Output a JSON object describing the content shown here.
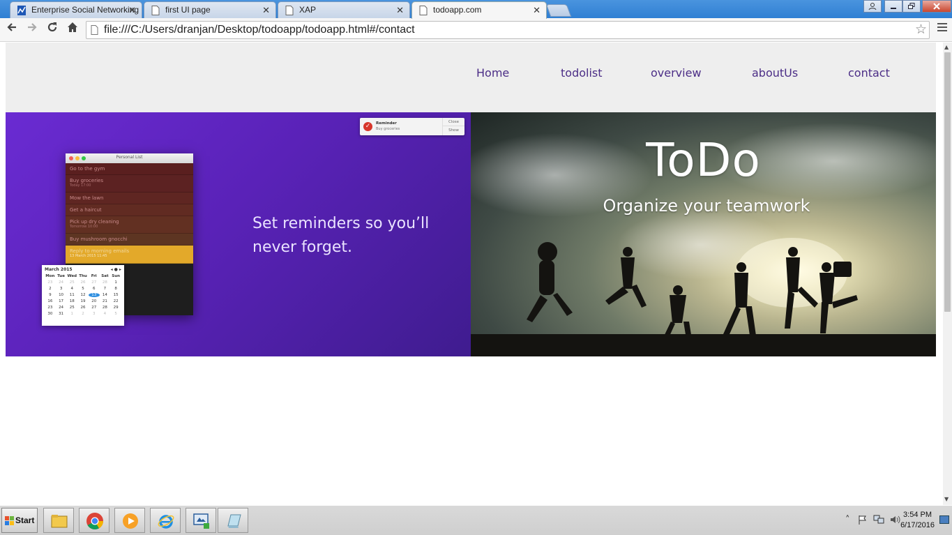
{
  "browser": {
    "tabs": [
      {
        "title": "Enterprise Social Networking",
        "active": false,
        "icon": "chart-favicon-icon"
      },
      {
        "title": "first UI page",
        "active": false,
        "icon": "page-icon"
      },
      {
        "title": "XAP",
        "active": false,
        "icon": "page-icon"
      },
      {
        "title": "todoapp.com",
        "active": true,
        "icon": "page-icon"
      }
    ],
    "tab_close_glyph": "✕",
    "url": "file:///C:/Users/dranjan/Desktop/todoapp/todoapp.html#/contact"
  },
  "site": {
    "nav": [
      "Home",
      "todolist",
      "overview",
      "aboutUs",
      "contact"
    ],
    "nav_color": "#4b2d86",
    "hero_left": {
      "tagline": "Set reminders so you’ll never forget.",
      "gradient": [
        "#6a2bd2",
        "#3f1c8f"
      ],
      "mock_app": {
        "title": "Personal List",
        "items": [
          {
            "text": "Go to the gym",
            "sub": ""
          },
          {
            "text": "Buy groceries",
            "sub": "Today 17:00"
          },
          {
            "text": "Mow the lawn",
            "sub": ""
          },
          {
            "text": "Get a haircut",
            "sub": ""
          },
          {
            "text": "Pick up dry cleaning",
            "sub": "Tomorrow 10:00"
          },
          {
            "text": "Buy mushroom gnocchi",
            "sub": ""
          },
          {
            "text": "Reply to morning emails",
            "sub": "13 March 2015 11:45"
          }
        ]
      },
      "calendar": {
        "month": "March 2015",
        "weekdays": [
          "Mon",
          "Tue",
          "Wed",
          "Thu",
          "Fri",
          "Sat",
          "Sun"
        ],
        "days": [
          "23",
          "24",
          "25",
          "26",
          "27",
          "28",
          "1",
          "2",
          "3",
          "4",
          "5",
          "6",
          "7",
          "8",
          "9",
          "10",
          "11",
          "12",
          "13",
          "14",
          "15",
          "16",
          "17",
          "18",
          "19",
          "20",
          "21",
          "22",
          "23",
          "24",
          "25",
          "26",
          "27",
          "28",
          "29",
          "30",
          "31",
          "1",
          "2",
          "3",
          "4",
          "5"
        ],
        "today": "13"
      },
      "reminder": {
        "title": "Reminder",
        "subtitle": "Buy groceries",
        "close": "Close",
        "show": "Show"
      }
    },
    "hero_right": {
      "title": "ToDo",
      "subtitle": "Organize your teamwork"
    }
  },
  "taskbar": {
    "start_label": "Start",
    "apps": [
      "file-explorer-icon",
      "chrome-icon",
      "media-player-icon",
      "internet-explorer-icon",
      "remote-desktop-icon",
      "notepad-icon"
    ],
    "time": "3:54 PM",
    "date": "6/17/2016"
  }
}
